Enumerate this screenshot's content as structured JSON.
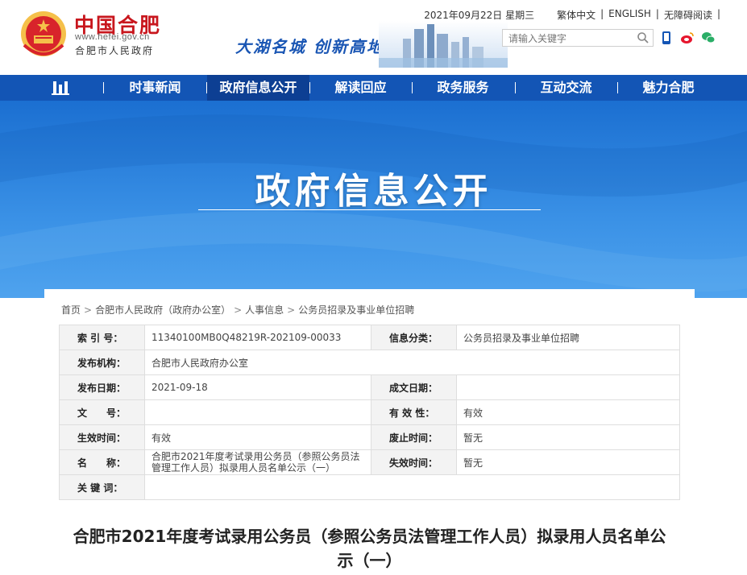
{
  "header": {
    "logo_cn": "中国合肥",
    "logo_url": "www.hefei.gov.cn",
    "logo_sub": "合肥市人民政府",
    "slogan": "大湖名城  创新高地",
    "date": "2021年09月22日 星期三",
    "links": [
      "繁体中文",
      "ENGLISH",
      "无障碍阅读"
    ],
    "search_placeholder": "请输入关键字"
  },
  "nav": {
    "items": [
      "时事新闻",
      "政府信息公开",
      "解读回应",
      "政务服务",
      "互动交流",
      "魅力合肥"
    ],
    "active": "政府信息公开"
  },
  "banner": {
    "title": "政府信息公开"
  },
  "breadcrumb": [
    "首页",
    "合肥市人民政府（政府办公室）",
    "人事信息",
    "公务员招录及事业单位招聘"
  ],
  "meta": {
    "index_label": "索 引 号：",
    "index_value": "11340100MB0Q48219R-202109-00033",
    "category_label": "信息分类：",
    "category_value": "公务员招录及事业单位招聘",
    "publisher_label": "发布机构：",
    "publisher_value": "合肥市人民政府办公室",
    "pubdate_label": "发布日期：",
    "pubdate_value": "2021-09-18",
    "createdate_label": "成文日期：",
    "createdate_value": "",
    "docno_label": "文　　号：",
    "docno_value": "",
    "validity_label": "有 效 性：",
    "validity_value": "有效",
    "effective_label": "生效时间：",
    "effective_value": "有效",
    "repeal_label": "废止时间：",
    "repeal_value": "暂无",
    "name_label": "名　　称：",
    "name_value": "合肥市2021年度考试录用公务员（参照公务员法管理工作人员）拟录用人员名单公示（一）",
    "expire_label": "失效时间：",
    "expire_value": "暂无",
    "keywords_label": "关 键 词：",
    "keywords_value": ""
  },
  "document": {
    "title": "合肥市2021年度考试录用公务员（参照公务员法管理工作人员）拟录用人员名单公示（一）"
  },
  "colors": {
    "nav_bg": "#1355b5",
    "nav_active": "#0d3f93",
    "logo_red": "#c8161d",
    "banner_blue": "#2a7fdc"
  }
}
